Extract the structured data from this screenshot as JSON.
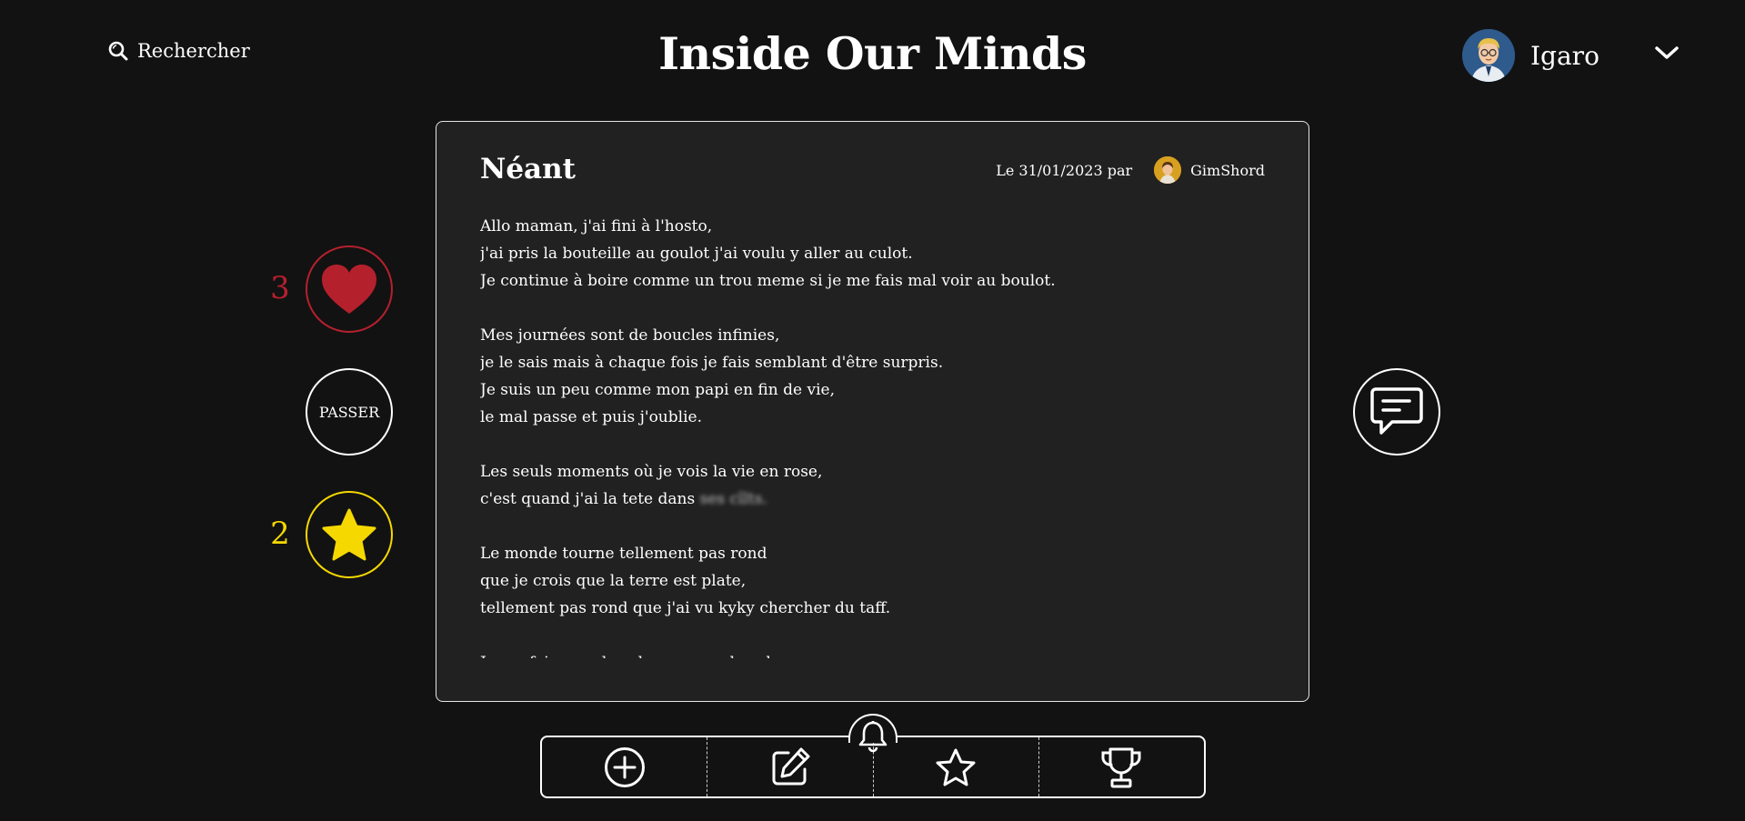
{
  "header": {
    "search_label": "Rechercher",
    "search_icon": "search-icon",
    "site_title": "Inside Our Minds",
    "user": {
      "name": "Igaro",
      "avatar_icon": "user-avatar",
      "menu_icon": "chevron-down-icon"
    }
  },
  "actions": {
    "like": {
      "count": "3",
      "icon": "heart-icon",
      "color": "#b5202d"
    },
    "skip": {
      "label": "PASSER"
    },
    "favorite": {
      "count": "2",
      "icon": "star-icon",
      "color": "#f5d800"
    },
    "comment": {
      "icon": "comment-icon"
    }
  },
  "poem": {
    "title": "Néant",
    "date_text": "Le 31/01/2023 par",
    "author": "GimShord",
    "stanzas": [
      {
        "lines": [
          "Allo maman, j'ai fini à l'hosto,",
          "j'ai pris la bouteille au goulot j'ai voulu y aller au culot.",
          "Je continue à boire comme un trou meme si je me fais mal voir au boulot."
        ]
      },
      {
        "lines": [
          "Mes journées sont de boucles infinies,",
          "je le sais mais à chaque fois je fais semblant d'être surpris.",
          "Je suis un peu comme mon papi en fin de vie,",
          "le mal passe et puis j'oublie."
        ]
      },
      {
        "lines": [
          "Les seuls moments où je vois la vie en rose,",
          "c'est quand j'ai la tete dans"
        ],
        "blurred_tail": "ses cîlts."
      },
      {
        "lines": [
          "Le monde tourne tellement pas rond",
          "que je crois que la terre est plate,",
          "tellement pas rond que j'ai vu kyky chercher du taff."
        ]
      },
      {
        "lines": [
          "Je me fais marcher dessus, cracher dessus,"
        ]
      }
    ]
  },
  "bottom_nav": {
    "items": [
      {
        "icon": "add-circle-icon"
      },
      {
        "icon": "edit-icon"
      },
      {
        "icon": "star-outline-icon"
      },
      {
        "icon": "trophy-icon"
      }
    ],
    "notification_icon": "bell-icon"
  },
  "colors": {
    "background": "#121212",
    "card": "#212121",
    "like": "#b5202d",
    "favorite": "#f5d800",
    "text": "#ffffff"
  }
}
